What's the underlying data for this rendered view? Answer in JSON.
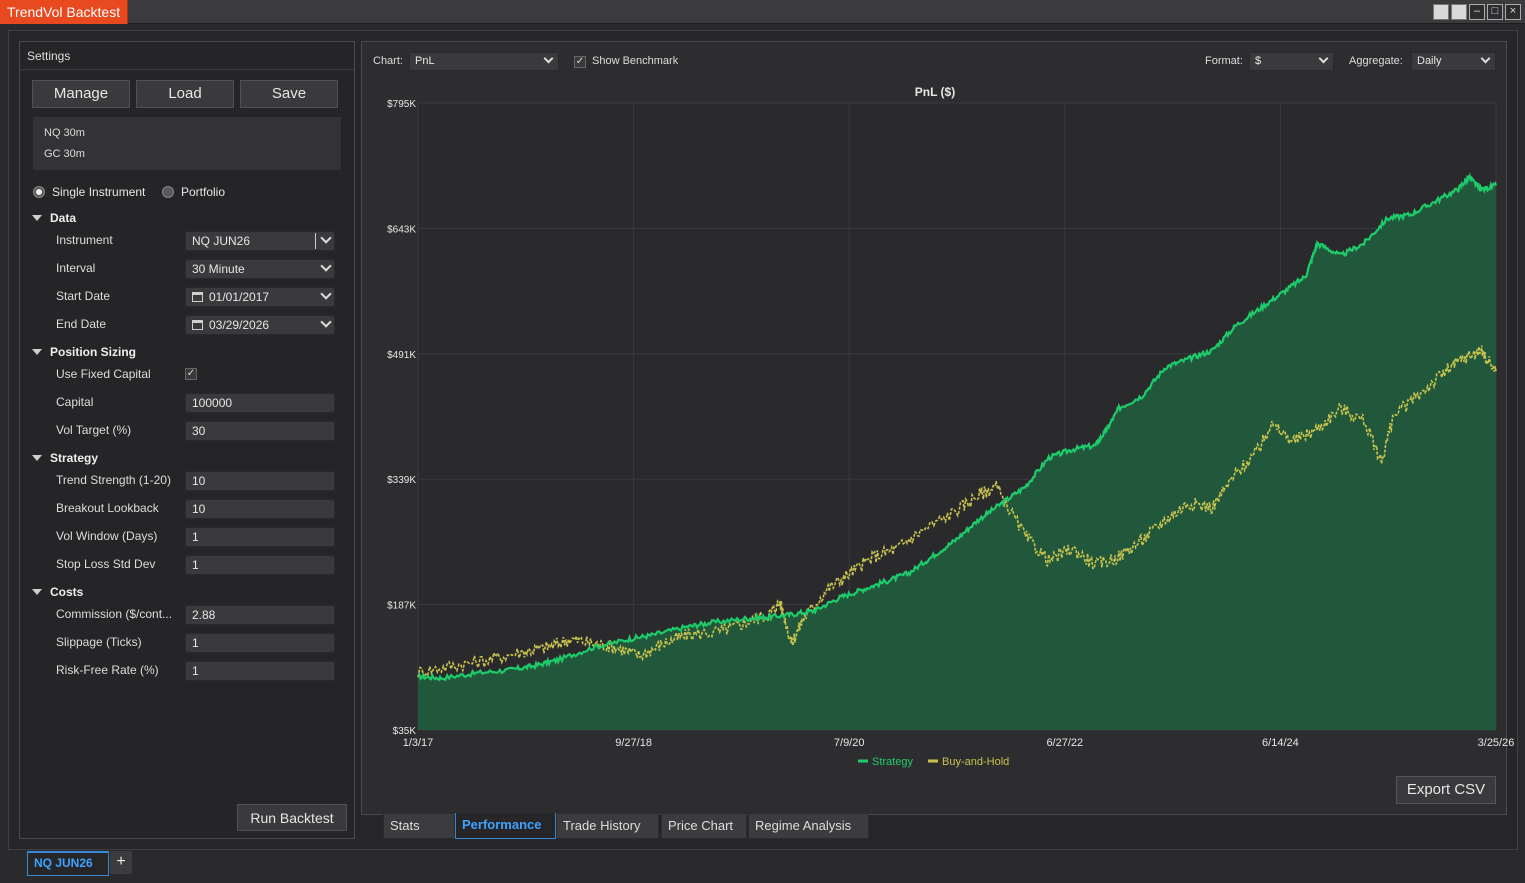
{
  "window": {
    "title": "TrendVol Backtest",
    "controls": [
      "□",
      "□",
      "–",
      "□",
      "×"
    ]
  },
  "settings": {
    "header": "Settings",
    "buttons": {
      "manage": "Manage",
      "load": "Load",
      "save": "Save",
      "run": "Run Backtest"
    },
    "presets": [
      "NQ 30m",
      "GC 30m"
    ],
    "mode": {
      "single": "Single Instrument",
      "portfolio": "Portfolio",
      "selected": "single"
    },
    "sections": {
      "data": {
        "title": "Data",
        "instrument_label": "Instrument",
        "instrument": "NQ JUN26",
        "interval_label": "Interval",
        "interval": "30 Minute",
        "start_label": "Start Date",
        "start": "01/01/2017",
        "end_label": "End Date",
        "end": "03/29/2026"
      },
      "sizing": {
        "title": "Position Sizing",
        "fixed_label": "Use Fixed Capital",
        "fixed_checked": true,
        "capital_label": "Capital",
        "capital": "100000",
        "vol_label": "Vol Target (%)",
        "vol": "30"
      },
      "strategy": {
        "title": "Strategy",
        "trend_label": "Trend Strength (1-20)",
        "trend": "10",
        "breakout_label": "Breakout Lookback",
        "breakout": "10",
        "volwin_label": "Vol Window (Days)",
        "volwin": "1",
        "stop_label": "Stop Loss Std Dev",
        "stop": "1"
      },
      "costs": {
        "title": "Costs",
        "commission_label": "Commission ($/cont...",
        "commission": "2.88",
        "slippage_label": "Slippage (Ticks)",
        "slippage": "1",
        "rf_label": "Risk-Free Rate (%)",
        "rf": "1"
      }
    }
  },
  "toolbar": {
    "chart_label": "Chart:",
    "chart_value": "PnL",
    "benchmark_label": "Show Benchmark",
    "benchmark_checked": true,
    "format_label": "Format:",
    "format_value": "$",
    "aggregate_label": "Aggregate:",
    "aggregate_value": "Daily"
  },
  "export_label": "Export CSV",
  "tabs": [
    "Stats",
    "Performance",
    "Trade History",
    "Price Chart",
    "Regime Analysis"
  ],
  "active_tab": "Performance",
  "doc_tab": "NQ JUN26",
  "chart_data": {
    "type": "area",
    "title": "PnL ($)",
    "xlabel": "",
    "ylabel": "",
    "y_ticks": [
      "$795K",
      "$643K",
      "$491K",
      "$339K",
      "$187K",
      "$35K"
    ],
    "x_ticks": [
      "1/3/17",
      "9/27/18",
      "7/9/20",
      "6/27/22",
      "6/14/24",
      "3/25/26"
    ],
    "ylim": [
      35,
      795
    ],
    "xlim": [
      2017.0,
      2026.23
    ],
    "grid": true,
    "legend_position": "bottom",
    "colors": {
      "strategy": "#1ecb6a",
      "benchmark": "#c8c24e",
      "fill": "#215a3c"
    },
    "series": [
      {
        "name": "Strategy",
        "points": [
          [
            2017.0,
            100
          ],
          [
            2017.2,
            98
          ],
          [
            2017.5,
            104
          ],
          [
            2017.8,
            108
          ],
          [
            2018.0,
            113
          ],
          [
            2018.2,
            120
          ],
          [
            2018.5,
            135
          ],
          [
            2018.8,
            145
          ],
          [
            2019.0,
            150
          ],
          [
            2019.3,
            160
          ],
          [
            2019.5,
            165
          ],
          [
            2019.8,
            170
          ],
          [
            2020.0,
            172
          ],
          [
            2020.2,
            175
          ],
          [
            2020.4,
            180
          ],
          [
            2020.6,
            195
          ],
          [
            2020.8,
            205
          ],
          [
            2021.0,
            215
          ],
          [
            2021.2,
            225
          ],
          [
            2021.4,
            245
          ],
          [
            2021.6,
            265
          ],
          [
            2021.8,
            290
          ],
          [
            2022.0,
            310
          ],
          [
            2022.2,
            330
          ],
          [
            2022.4,
            365
          ],
          [
            2022.6,
            375
          ],
          [
            2022.8,
            380
          ],
          [
            2022.9,
            400
          ],
          [
            2023.0,
            425
          ],
          [
            2023.2,
            440
          ],
          [
            2023.4,
            475
          ],
          [
            2023.6,
            485
          ],
          [
            2023.8,
            495
          ],
          [
            2024.0,
            525
          ],
          [
            2024.2,
            545
          ],
          [
            2024.4,
            565
          ],
          [
            2024.6,
            585
          ],
          [
            2024.7,
            625
          ],
          [
            2024.9,
            610
          ],
          [
            2025.1,
            625
          ],
          [
            2025.3,
            655
          ],
          [
            2025.5,
            660
          ],
          [
            2025.7,
            675
          ],
          [
            2025.9,
            690
          ],
          [
            2026.0,
            705
          ],
          [
            2026.1,
            690
          ],
          [
            2026.23,
            695
          ]
        ]
      },
      {
        "name": "Buy-and-Hold",
        "points": [
          [
            2017.0,
            105
          ],
          [
            2017.3,
            113
          ],
          [
            2017.6,
            120
          ],
          [
            2017.9,
            130
          ],
          [
            2018.1,
            135
          ],
          [
            2018.3,
            145
          ],
          [
            2018.5,
            140
          ],
          [
            2018.7,
            135
          ],
          [
            2018.9,
            125
          ],
          [
            2019.1,
            140
          ],
          [
            2019.3,
            150
          ],
          [
            2019.6,
            155
          ],
          [
            2019.8,
            165
          ],
          [
            2020.0,
            175
          ],
          [
            2020.1,
            190
          ],
          [
            2020.2,
            140
          ],
          [
            2020.3,
            170
          ],
          [
            2020.5,
            205
          ],
          [
            2020.7,
            225
          ],
          [
            2020.9,
            245
          ],
          [
            2021.1,
            255
          ],
          [
            2021.3,
            275
          ],
          [
            2021.6,
            300
          ],
          [
            2021.8,
            320
          ],
          [
            2021.95,
            330
          ],
          [
            2022.2,
            270
          ],
          [
            2022.4,
            240
          ],
          [
            2022.6,
            255
          ],
          [
            2022.8,
            235
          ],
          [
            2023.0,
            245
          ],
          [
            2023.2,
            265
          ],
          [
            2023.4,
            290
          ],
          [
            2023.6,
            310
          ],
          [
            2023.8,
            305
          ],
          [
            2024.0,
            345
          ],
          [
            2024.2,
            375
          ],
          [
            2024.3,
            405
          ],
          [
            2024.5,
            385
          ],
          [
            2024.7,
            400
          ],
          [
            2024.9,
            425
          ],
          [
            2025.1,
            410
          ],
          [
            2025.25,
            360
          ],
          [
            2025.35,
            415
          ],
          [
            2025.6,
            445
          ],
          [
            2025.8,
            470
          ],
          [
            2025.95,
            485
          ],
          [
            2026.1,
            495
          ],
          [
            2026.23,
            470
          ]
        ]
      }
    ]
  }
}
